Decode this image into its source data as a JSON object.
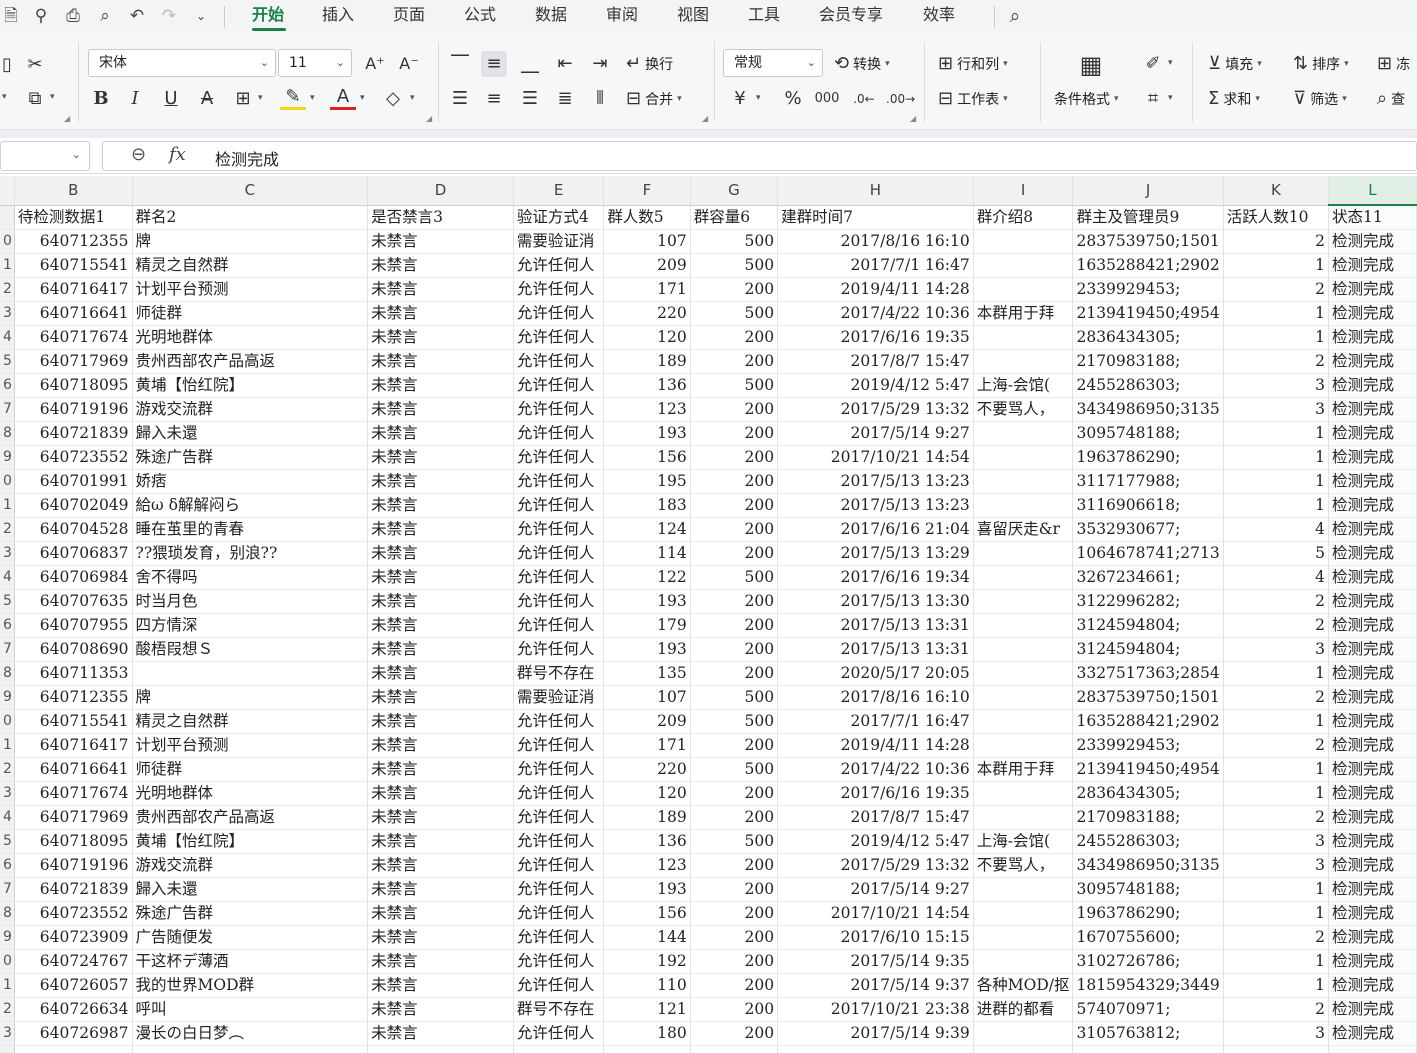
{
  "menubar": {
    "tabs": [
      "开始",
      "插入",
      "页面",
      "公式",
      "数据",
      "审阅",
      "视图",
      "工具",
      "会员专享",
      "效率"
    ],
    "active_tab": "开始",
    "accent": "#1a7f4b"
  },
  "ribbon": {
    "font_name": "宋体",
    "font_size": "11",
    "wrap_label": "换行",
    "merge_label": "合并",
    "number_format": "常规",
    "convert_label": "转换",
    "rowcol_label": "行和列",
    "worksheet_label": "工作表",
    "cond_format_label": "条件格式",
    "fill_label": "填充",
    "sort_label": "排序",
    "freeze_label": "冻",
    "sum_label": "求和",
    "filter_label": "筛选",
    "find_label": "查"
  },
  "formula_bar": {
    "name_box": "",
    "formula": "检测完成"
  },
  "sheet": {
    "selected_column": "L",
    "column_letters": [
      "B",
      "C",
      "D",
      "E",
      "F",
      "G",
      "H",
      "I",
      "J",
      "K",
      "L"
    ],
    "header_row": [
      "待检测数据1",
      "群名2",
      "是否禁言3",
      "验证方式4",
      "群人数5",
      "群容量6",
      "建群时间7",
      "群介绍8",
      "群主及管理员9",
      "活跃人数10",
      "状态11"
    ],
    "row_numbers": [
      "0",
      "1",
      "2",
      "3",
      "4",
      "5",
      "6",
      "7",
      "8",
      "9",
      "0",
      "1",
      "2",
      "3",
      "4",
      "5",
      "6",
      "7",
      "8",
      "9",
      "0",
      "1",
      "2",
      "3",
      "4",
      "5",
      "6",
      "7",
      "8",
      "9",
      "0",
      "1",
      "2",
      "3",
      ""
    ],
    "rows": [
      [
        "640712355",
        "牌",
        "未禁言",
        "需要验证消",
        "107",
        "500",
        "2017/8/16 16:10",
        "",
        "2837539750;1501",
        "2",
        "检测完成"
      ],
      [
        "640715541",
        "精灵之自然群",
        "未禁言",
        "允许任何人",
        "209",
        "500",
        "2017/7/1 16:47",
        "",
        "1635288421;2902",
        "1",
        "检测完成"
      ],
      [
        "640716417",
        "计划平台预测",
        "未禁言",
        "允许任何人",
        "171",
        "200",
        "2019/4/11 14:28",
        "",
        "2339929453;",
        "2",
        "检测完成"
      ],
      [
        "640716641",
        "师徒群",
        "未禁言",
        "允许任何人",
        "220",
        "500",
        "2017/4/22 10:36",
        "本群用于拜",
        "2139419450;4954",
        "1",
        "检测完成"
      ],
      [
        "640717674",
        "光明地群体",
        "未禁言",
        "允许任何人",
        "120",
        "200",
        "2017/6/16 19:35",
        "",
        "2836434305;",
        "1",
        "检测完成"
      ],
      [
        "640717969",
        "贵州西部农产品高返",
        "未禁言",
        "允许任何人",
        "189",
        "200",
        "2017/8/7 15:47",
        "",
        "2170983188;",
        "2",
        "检测完成"
      ],
      [
        "640718095",
        "黄埔【怡红院】",
        "未禁言",
        "允许任何人",
        "136",
        "500",
        "2019/4/12 5:47",
        "上海-会馆(",
        "2455286303;",
        "3",
        "检测完成"
      ],
      [
        "640719196",
        "游戏交流群",
        "未禁言",
        "允许任何人",
        "123",
        "200",
        "2017/5/29 13:32",
        "不要骂人，",
        "3434986950;3135",
        "3",
        "检测完成"
      ],
      [
        "640721839",
        "歸入未還",
        "未禁言",
        "允许任何人",
        "193",
        "200",
        "2017/5/14 9:27",
        "",
        "3095748188;",
        "1",
        "检测完成"
      ],
      [
        "640723552",
        "殊途广告群",
        "未禁言",
        "允许任何人",
        "156",
        "200",
        "2017/10/21 14:54",
        "",
        "1963786290;",
        "1",
        "检测完成"
      ],
      [
        "640701991",
        "娇痞",
        "未禁言",
        "允许任何人",
        "195",
        "200",
        "2017/5/13 13:23",
        "",
        "3117177988;",
        "1",
        "检测完成"
      ],
      [
        "640702049",
        "給ω δ解解闷ら",
        "未禁言",
        "允许任何人",
        "183",
        "200",
        "2017/5/13 13:23",
        "",
        "3116906618;",
        "1",
        "检测完成"
      ],
      [
        "640704528",
        "睡在茧里的青春",
        "未禁言",
        "允许任何人",
        "124",
        "200",
        "2017/6/16 21:04",
        "喜留厌走&r",
        "3532930677;",
        "4",
        "检测完成"
      ],
      [
        "640706837",
        "??猥琐发育，别浪??",
        "未禁言",
        "允许任何人",
        "114",
        "200",
        "2017/5/13 13:29",
        "",
        "1064678741;2713",
        "5",
        "检测完成"
      ],
      [
        "640706984",
        "舍不得吗",
        "未禁言",
        "允许任何人",
        "122",
        "500",
        "2017/6/16 19:34",
        "",
        "3267234661;",
        "4",
        "检测完成"
      ],
      [
        "640707635",
        "时当月色",
        "未禁言",
        "允许任何人",
        "193",
        "200",
        "2017/5/13 13:30",
        "",
        "3122996282;",
        "2",
        "检测完成"
      ],
      [
        "640707955",
        "四方情深",
        "未禁言",
        "允许任何人",
        "179",
        "200",
        "2017/5/13 13:31",
        "",
        "3124594804;",
        "2",
        "检测完成"
      ],
      [
        "640708690",
        "酸梧叚想Ｓ",
        "未禁言",
        "允许任何人",
        "193",
        "200",
        "2017/5/13 13:31",
        "",
        "3124594804;",
        "3",
        "检测完成"
      ],
      [
        "640711353",
        "",
        "未禁言",
        "群号不存在",
        "135",
        "200",
        "2020/5/17 20:05",
        "",
        "3327517363;2854",
        "1",
        "检测完成"
      ],
      [
        "640712355",
        "牌",
        "未禁言",
        "需要验证消",
        "107",
        "500",
        "2017/8/16 16:10",
        "",
        "2837539750;1501",
        "2",
        "检测完成"
      ],
      [
        "640715541",
        "精灵之自然群",
        "未禁言",
        "允许任何人",
        "209",
        "500",
        "2017/7/1 16:47",
        "",
        "1635288421;2902",
        "1",
        "检测完成"
      ],
      [
        "640716417",
        "计划平台预测",
        "未禁言",
        "允许任何人",
        "171",
        "200",
        "2019/4/11 14:28",
        "",
        "2339929453;",
        "2",
        "检测完成"
      ],
      [
        "640716641",
        "师徒群",
        "未禁言",
        "允许任何人",
        "220",
        "500",
        "2017/4/22 10:36",
        "本群用于拜",
        "2139419450;4954",
        "1",
        "检测完成"
      ],
      [
        "640717674",
        "光明地群体",
        "未禁言",
        "允许任何人",
        "120",
        "200",
        "2017/6/16 19:35",
        "",
        "2836434305;",
        "1",
        "检测完成"
      ],
      [
        "640717969",
        "贵州西部农产品高返",
        "未禁言",
        "允许任何人",
        "189",
        "200",
        "2017/8/7 15:47",
        "",
        "2170983188;",
        "2",
        "检测完成"
      ],
      [
        "640718095",
        "黄埔【怡红院】",
        "未禁言",
        "允许任何人",
        "136",
        "500",
        "2019/4/12 5:47",
        "上海-会馆(",
        "2455286303;",
        "3",
        "检测完成"
      ],
      [
        "640719196",
        "游戏交流群",
        "未禁言",
        "允许任何人",
        "123",
        "200",
        "2017/5/29 13:32",
        "不要骂人，",
        "3434986950;3135",
        "3",
        "检测完成"
      ],
      [
        "640721839",
        "歸入未還",
        "未禁言",
        "允许任何人",
        "193",
        "200",
        "2017/5/14 9:27",
        "",
        "3095748188;",
        "1",
        "检测完成"
      ],
      [
        "640723552",
        "殊途广告群",
        "未禁言",
        "允许任何人",
        "156",
        "200",
        "2017/10/21 14:54",
        "",
        "1963786290;",
        "1",
        "检测完成"
      ],
      [
        "640723909",
        "广告随便发",
        "未禁言",
        "允许任何人",
        "144",
        "200",
        "2017/6/10 15:15",
        "",
        "1670755600;",
        "2",
        "检测完成"
      ],
      [
        "640724767",
        "干这杯デ薄酒",
        "未禁言",
        "允许任何人",
        "192",
        "200",
        "2017/5/14 9:35",
        "",
        "3102726786;",
        "1",
        "检测完成"
      ],
      [
        "640726057",
        "我的世界MOD群",
        "未禁言",
        "允许任何人",
        "110",
        "200",
        "2017/5/14 9:37",
        "各种MOD/抠",
        "1815954329;3449",
        "1",
        "检测完成"
      ],
      [
        "640726634",
        "呼叫",
        "未禁言",
        "群号不存在",
        "121",
        "200",
        "2017/10/21 23:38",
        "进群的都看",
        "574070971;",
        "2",
        "检测完成"
      ],
      [
        "640726987",
        "漫长の白日梦︵",
        "未禁言",
        "允许任何人",
        "180",
        "200",
        "2017/5/14 9:39",
        "",
        "3105763812;",
        "3",
        "检测完成"
      ],
      [
        "",
        "",
        "",
        "",
        "",
        "",
        "",
        "",
        "",
        "",
        ""
      ]
    ]
  }
}
